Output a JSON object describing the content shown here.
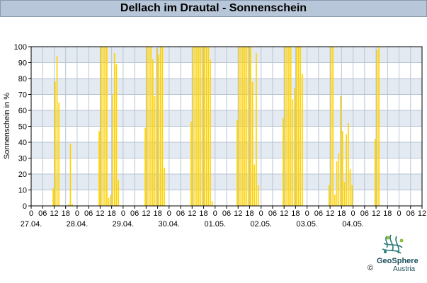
{
  "page_title": "Dellach im Drautal - Sonnenschein",
  "logo": {
    "name": "GeoSphere",
    "sub": "Austria",
    "copyright": "©"
  },
  "chart_data": {
    "type": "bar",
    "title": "Dellach im Drautal - Sonnenschein",
    "xlabel": "",
    "ylabel": "Sonnenschein in %",
    "ylim": [
      0,
      100
    ],
    "yticks": [
      0,
      10,
      20,
      30,
      40,
      50,
      60,
      70,
      80,
      90,
      100
    ],
    "grid": true,
    "x_start": "27.04. 00:00",
    "interval_hours": 1,
    "hour_ticks": [
      "0",
      "06",
      "12",
      "18",
      "0",
      "06",
      "12",
      "18",
      "0",
      "06",
      "12",
      "18",
      "0",
      "06",
      "12",
      "18",
      "0",
      "06",
      "12",
      "18",
      "0",
      "06",
      "12",
      "18",
      "0",
      "06",
      "12",
      "18",
      "0",
      "06",
      "12",
      "18",
      "0",
      "06",
      "12"
    ],
    "day_labels": [
      "27.04.",
      "28.04.",
      "29.04.",
      "30.04.",
      "01.05.",
      "02.05.",
      "03.05.",
      "04.05."
    ],
    "values": [
      0,
      0,
      0,
      0,
      0,
      0,
      0,
      0,
      0,
      0,
      0,
      11,
      78,
      94,
      65,
      0,
      0,
      0,
      0,
      1,
      39,
      1,
      0,
      0,
      0,
      0,
      0,
      0,
      0,
      0,
      0,
      0,
      0,
      0,
      0,
      47,
      100,
      100,
      100,
      100,
      5,
      7,
      70,
      96,
      89,
      16,
      0,
      0,
      0,
      0,
      0,
      0,
      0,
      0,
      0,
      0,
      0,
      0,
      0,
      49,
      100,
      100,
      100,
      92,
      69,
      99,
      95,
      100,
      100,
      24,
      0,
      0,
      0,
      0,
      0,
      0,
      0,
      0,
      0,
      0,
      0,
      0,
      0,
      53,
      100,
      100,
      100,
      100,
      100,
      100,
      100,
      100,
      100,
      92,
      3,
      0,
      0,
      0,
      0,
      0,
      0,
      0,
      0,
      0,
      0,
      0,
      0,
      54,
      100,
      100,
      100,
      100,
      100,
      100,
      100,
      78,
      26,
      96,
      13,
      0,
      0,
      0,
      0,
      0,
      0,
      0,
      0,
      0,
      0,
      0,
      0,
      55,
      100,
      100,
      100,
      100,
      67,
      74,
      100,
      100,
      100,
      83,
      0,
      0,
      0,
      0,
      0,
      0,
      0,
      0,
      0,
      0,
      0,
      0,
      0,
      13,
      100,
      100,
      7,
      28,
      33,
      69,
      47,
      15,
      45,
      52,
      23,
      13,
      0,
      0,
      0,
      0,
      0,
      0,
      0,
      0,
      0,
      0,
      0,
      42,
      98,
      100,
      0
    ],
    "bar_color": "#ffd200",
    "band_color": "#e3eaf2"
  }
}
